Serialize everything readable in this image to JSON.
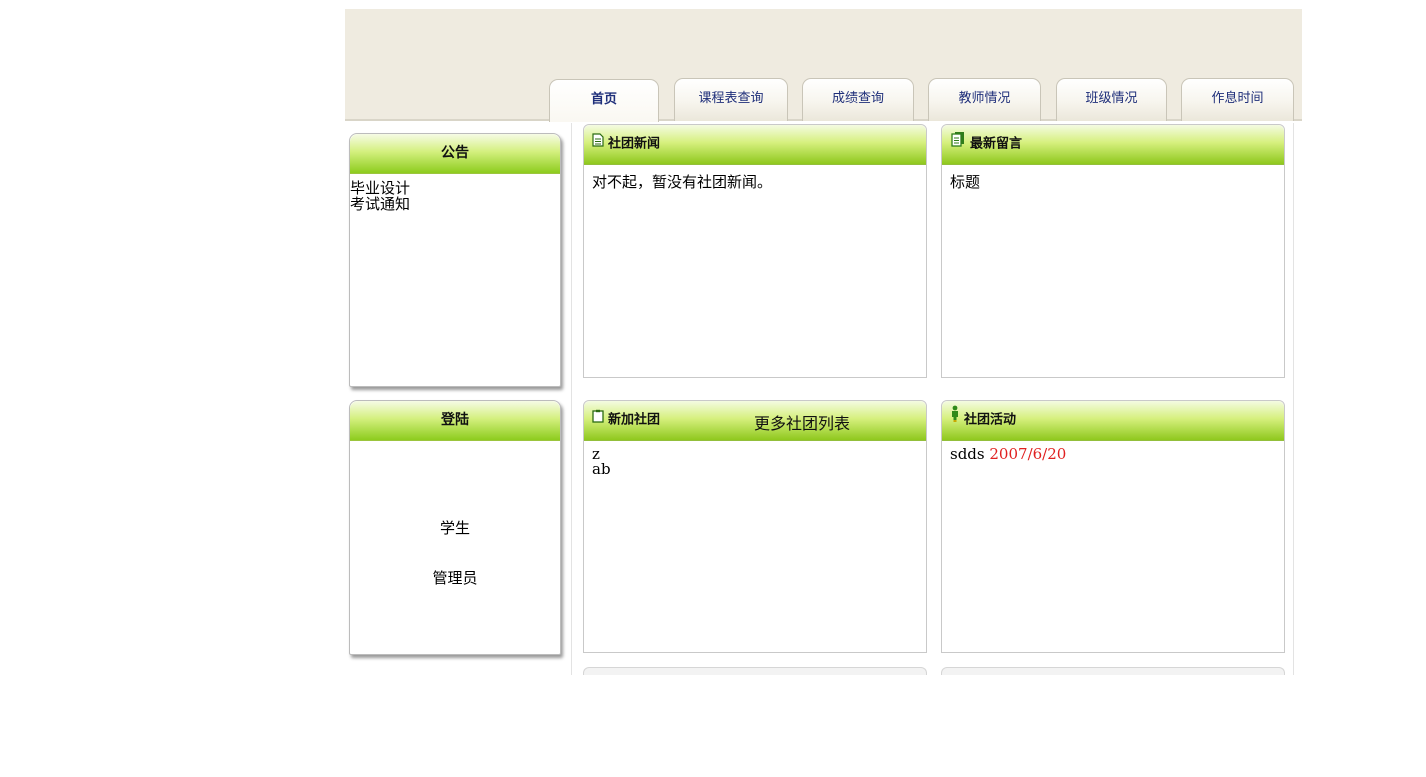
{
  "tabs": [
    {
      "label": "首页"
    },
    {
      "label": "课程表查询"
    },
    {
      "label": "成绩查询"
    },
    {
      "label": "教师情况"
    },
    {
      "label": "班级情况"
    },
    {
      "label": "作息时间"
    }
  ],
  "sidebar": {
    "announcement": {
      "title": "公告",
      "items": [
        "毕业设计",
        "考试通知"
      ]
    },
    "login": {
      "title": "登陆",
      "options": [
        "学生",
        "管理员"
      ]
    }
  },
  "panels": {
    "club_news": {
      "title": "社团新闻",
      "body": "对不起，暂没有社团新闻。"
    },
    "latest_messages": {
      "title": "最新留言",
      "body": "标题"
    },
    "new_clubs": {
      "title": "新加社团",
      "more_link": "更多社团列表",
      "items": [
        "z",
        "ab"
      ]
    },
    "club_activities": {
      "title": "社团活动",
      "items": [
        {
          "name": "sdds",
          "date": "2007/6/20"
        }
      ]
    }
  },
  "colors": {
    "header_bg": "#efebe0",
    "panel_header_green": "#8fc81e",
    "tab_text": "#1f2f7a",
    "date_red": "#e02020"
  }
}
